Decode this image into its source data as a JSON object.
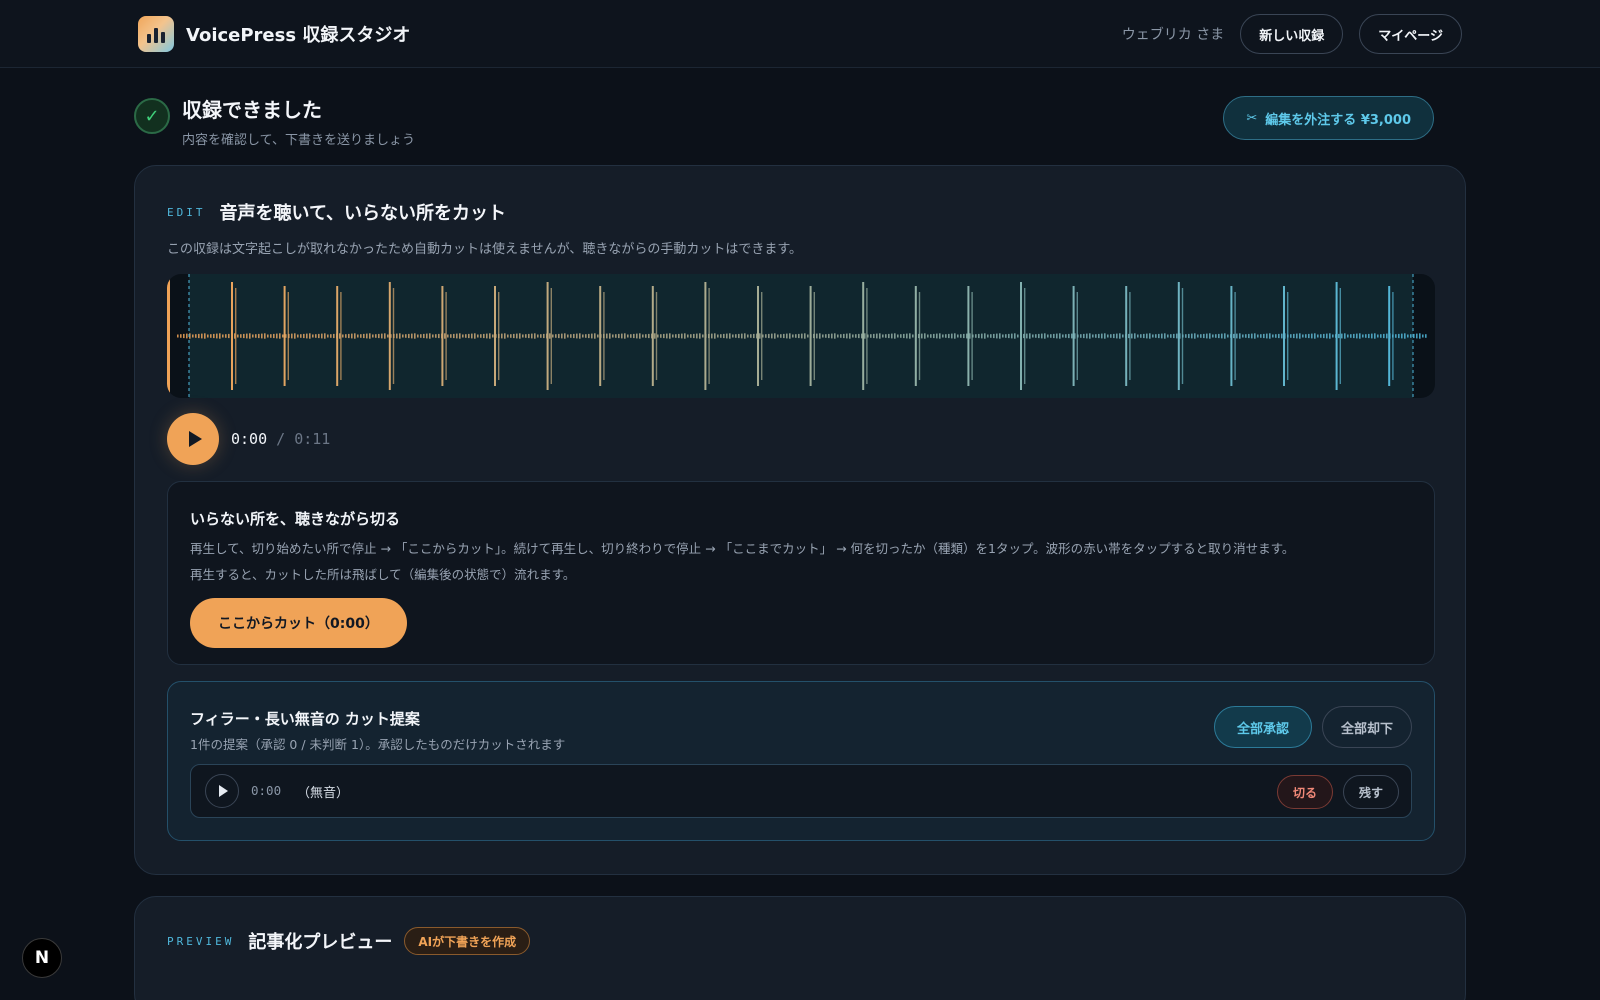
{
  "header": {
    "app_title": "VoicePress 収録スタジオ",
    "user_label": "ウェブリカ さま",
    "new_recording_label": "新しい収録",
    "mypage_label": "マイページ"
  },
  "status": {
    "title": "収録できました",
    "subtitle": "内容を確認して、下書きを送りましょう",
    "check_glyph": "✓"
  },
  "outsource": {
    "icon_glyph": "✂",
    "label": "編集を外注する ¥3,000"
  },
  "edit": {
    "eyebrow": "EDIT",
    "title": "音声を聴いて、いらない所をカット",
    "description": "この収録は文字起こしが取れなかったため自動カットは使えませんが、聴きながらの手動カットはできます。",
    "current_time": "0:00",
    "separator": "/",
    "total_time": "0:11",
    "waveform": {
      "start_color": "#f0a357",
      "end_color": "#4fb7db",
      "spike_count": 24
    }
  },
  "manual_cut": {
    "title": "いらない所を、聴きながら切る",
    "line1": "再生して、切り始めたい所で停止 → 「ここからカット」。続けて再生し、切り終わりで停止 → 「ここまでカット」 → 何を切ったか（種類）を1タップ。波形の赤い帯をタップすると取り消せます。",
    "line2": "再生すると、カットした所は飛ばして（編集後の状態で）流れます。",
    "cut_button_label": "ここからカット（0:00）"
  },
  "suggestions": {
    "title": "フィラー・長い無音の カット提案",
    "subtitle": "1件の提案（承認 0 / 未判断 1）。承認したものだけカットされます",
    "accept_all_label": "全部承認",
    "reject_all_label": "全部却下",
    "items": [
      {
        "time": "0:00",
        "kind": "（無音）",
        "cut_label": "切る",
        "keep_label": "残す"
      }
    ]
  },
  "preview": {
    "eyebrow": "PREVIEW",
    "title": "記事化プレビュー",
    "badge": "AIが下書きを作成"
  },
  "dev_badge": "N"
}
